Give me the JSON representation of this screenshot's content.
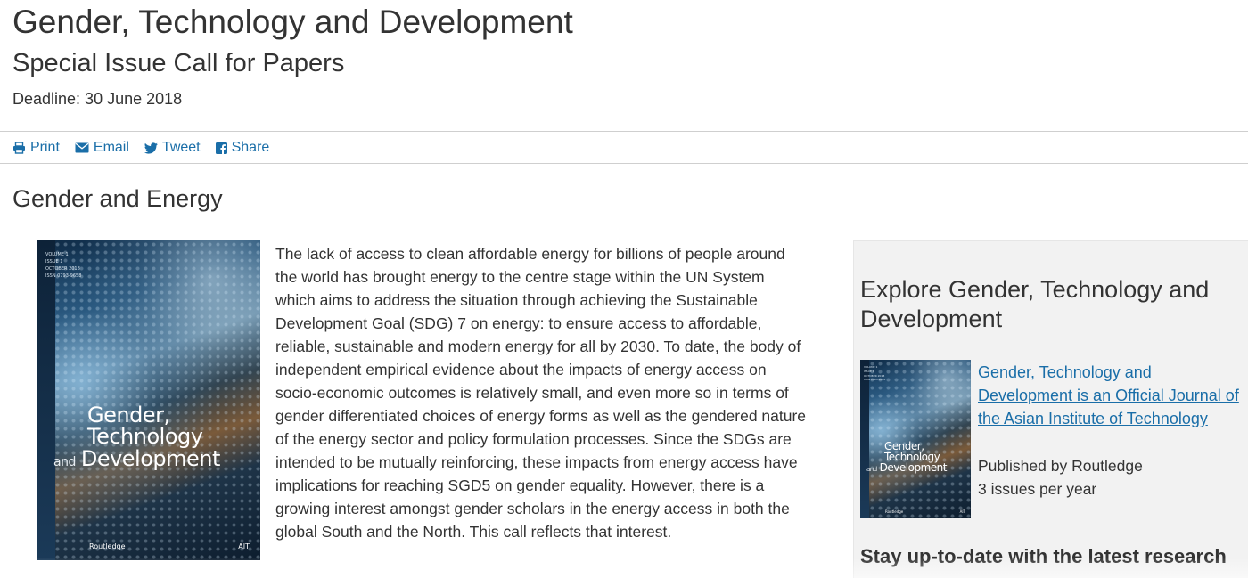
{
  "header": {
    "title": "Gender, Technology and Development",
    "subtitle": "Special Issue Call for Papers",
    "deadline": "Deadline: 30 June 2018"
  },
  "share_bar": {
    "print_label": "Print",
    "email_label": "Email",
    "tweet_label": "Tweet",
    "share_label": "Share",
    "icons": [
      "print-icon",
      "email-icon",
      "twitter-icon",
      "facebook-icon"
    ],
    "link_color": "#1a6ea8"
  },
  "section": {
    "title": "Gender and Energy",
    "body": "The lack of access to clean affordable energy for billions of people around the world has brought energy to the centre stage within the UN System which aims to address the situation through achieving the Sustainable Development Goal (SDG) 7 on energy: to ensure access to affordable, reliable, sustainable and modern energy for all by 2030. To date, the body of independent empirical evidence about the impacts of energy access on socio-economic outcomes is relatively small, and even more so in terms of gender differentiated choices of energy forms as well as the gendered nature of the energy sector and policy formulation processes. Since the SDGs are intended to be mutually reinforcing, these impacts from energy access have implications for reaching SGD5 on gender equality. However, there is a growing interest amongst gender scholars in the energy access in both the global South and the North. This call reflects that interest."
  },
  "cover": {
    "volume": "VOLUME 1",
    "issue": "ISSUE 1",
    "date": "OCTOBER 2018",
    "issn": "ISSN 0793-9658",
    "title_line1": "Gender,",
    "title_line2": "Technology",
    "title_and": "and",
    "title_line3": "Development",
    "publisher": "Routledge",
    "partner": "AIT"
  },
  "sidebar": {
    "title": "Explore Gender, Technology and Development",
    "journal_link": "Gender, Technology and Development is an Official Journal of the Asian Institute of Technology",
    "published_by": "Published by Routledge",
    "frequency": "3 issues per year",
    "stay_heading": "Stay up-to-date with the latest research"
  }
}
